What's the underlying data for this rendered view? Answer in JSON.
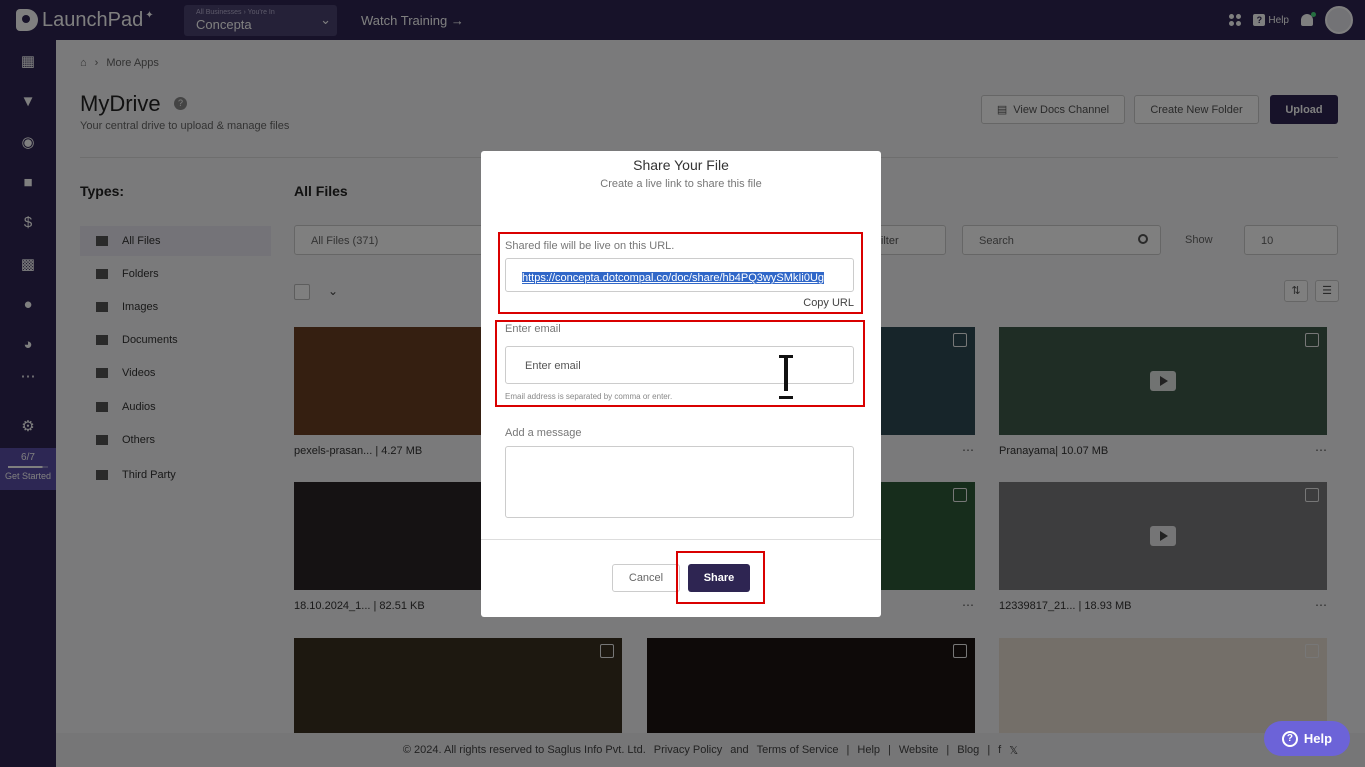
{
  "topbar": {
    "logo": "LaunchPad",
    "business_caption": "All Businesses › You're In",
    "business_name": "Concepta",
    "watch_training": "Watch Training →",
    "help_label": "Help",
    "icons": [
      "apps-grid-icon",
      "help-icon",
      "bell-icon",
      "avatar"
    ]
  },
  "sidebar": {
    "icons": [
      "dashboard-icon",
      "funnel-icon",
      "globe-icon",
      "video-icon",
      "dollar-icon",
      "analytics-icon",
      "users-icon",
      "reports-icon",
      "more-icon",
      "settings-icon"
    ],
    "get_started_count": "6/7",
    "get_started_label": "Get Started",
    "get_started_progress": 0.857
  },
  "breadcrumb": {
    "current": "More Apps"
  },
  "page": {
    "title": "MyDrive",
    "subtitle": "Your central drive to upload & manage files",
    "view_docs_channel": "View Docs Channel",
    "create_new_folder": "Create New Folder",
    "upload": "Upload"
  },
  "types": {
    "title": "Types:",
    "items": [
      {
        "label": "All Files",
        "icon": "grid-icon"
      },
      {
        "label": "Folders",
        "icon": "folder-icon"
      },
      {
        "label": "Images",
        "icon": "image-icon"
      },
      {
        "label": "Documents",
        "icon": "document-icon"
      },
      {
        "label": "Videos",
        "icon": "video-icon"
      },
      {
        "label": "Audios",
        "icon": "music-icon"
      },
      {
        "label": "Others",
        "icon": "file-icon"
      },
      {
        "label": "Third Party",
        "icon": "third-party-icon"
      }
    ]
  },
  "files": {
    "title": "All Files",
    "filter_value": "All Files (371)",
    "advanced_filter": "d Filter",
    "search_placeholder": "Search",
    "show_label": "Show",
    "show_value": "10",
    "cards": [
      {
        "label": "pexels-prasan... | 4.27 MB"
      },
      {
        "label": ""
      },
      {
        "label": "Pranayama| 10.07 MB"
      },
      {
        "label": "18.10.2024_1... | 82.51 KB"
      },
      {
        "label": ""
      },
      {
        "label": "12339817_21... | 18.93 MB"
      }
    ]
  },
  "footer": {
    "copyright": "©  2024. All rights reserved to Saglus Info Pvt. Ltd.",
    "privacy": "Privacy Policy",
    "and": "and",
    "terms": "Terms of Service",
    "help": "Help",
    "website": "Website",
    "blog": "Blog"
  },
  "help_button": "Help",
  "modal": {
    "title": "Share Your File",
    "subtitle": "Create a live link to share this file",
    "url_label": "Shared file will be live on this URL.",
    "url": "https://concepta.dotcompal.co/doc/share/hb4PQ3wySMkIi0Ug",
    "copy_url": "Copy URL",
    "email_label": "Enter email",
    "email_placeholder": "Enter email",
    "email_hint": "Email address is separated by comma or enter.",
    "message_label": "Add a message",
    "cancel": "Cancel",
    "share": "Share"
  }
}
